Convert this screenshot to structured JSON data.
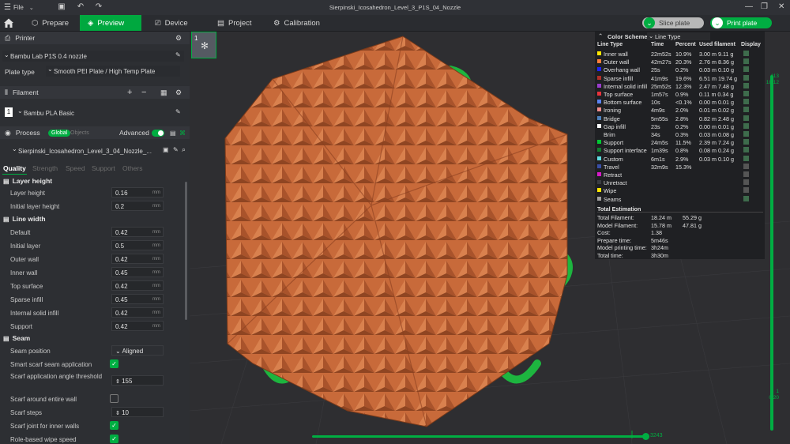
{
  "titlebar": {
    "menu_label": "File",
    "title": "Sierpinski_Icosahedron_Level_3_P1S_04_Nozzle"
  },
  "tabs": [
    {
      "label": "Prepare"
    },
    {
      "label": "Preview"
    },
    {
      "label": "Device"
    },
    {
      "label": "Project"
    },
    {
      "label": "Calibration"
    }
  ],
  "actions": {
    "slice": "Slice plate",
    "print": "Print plate"
  },
  "printer": {
    "section": "Printer",
    "name": "Bambu Lab P1S 0.4 nozzle",
    "plate_label": "Plate type",
    "plate_value": "Smooth PEI Plate / High Temp Plate"
  },
  "filament": {
    "section": "Filament",
    "slot": "1",
    "name": "Bambu PLA Basic"
  },
  "process": {
    "section": "Process",
    "global": "Global",
    "objects": "Objects",
    "advanced": "Advanced",
    "profile": "Sierpinski_Icosahedron_Level_3_04_Nozzle_..."
  },
  "subtabs": [
    "Quality",
    "Strength",
    "Speed",
    "Support",
    "Others"
  ],
  "layer_height": {
    "title": "Layer height",
    "rows": [
      {
        "label": "Layer height",
        "value": "0.16",
        "unit": "mm"
      },
      {
        "label": "Initial layer height",
        "value": "0.2",
        "unit": "mm"
      }
    ]
  },
  "line_width": {
    "title": "Line width",
    "rows": [
      {
        "label": "Default",
        "value": "0.42",
        "unit": "mm"
      },
      {
        "label": "Initial layer",
        "value": "0.5",
        "unit": "mm"
      },
      {
        "label": "Outer wall",
        "value": "0.42",
        "unit": "mm"
      },
      {
        "label": "Inner wall",
        "value": "0.45",
        "unit": "mm"
      },
      {
        "label": "Top surface",
        "value": "0.42",
        "unit": "mm"
      },
      {
        "label": "Sparse infill",
        "value": "0.45",
        "unit": "mm"
      },
      {
        "label": "Internal solid infill",
        "value": "0.42",
        "unit": "mm"
      },
      {
        "label": "Support",
        "value": "0.42",
        "unit": "mm"
      }
    ]
  },
  "seam": {
    "title": "Seam",
    "position_label": "Seam position",
    "position_value": "Aligned",
    "smart_label": "Smart scarf seam application",
    "angle_label": "Scarf application angle threshold",
    "angle_value": "155",
    "around_label": "Scarf around entire wall",
    "steps_label": "Scarf steps",
    "steps_value": "10",
    "inner_label": "Scarf joint for inner walls",
    "wipe_label": "Role-based wipe speed"
  },
  "legend": {
    "header": "Color Scheme",
    "scheme": "Line Type",
    "cols": [
      "Line Type",
      "Time",
      "Percent",
      "Used filament",
      "Display"
    ],
    "rows": [
      {
        "name": "Inner wall",
        "time": "22m52s",
        "pct": "10.9%",
        "used": "3.00 m  9.11 g",
        "color": "#ffe600",
        "on": true
      },
      {
        "name": "Outer wall",
        "time": "42m27s",
        "pct": "20.3%",
        "used": "2.76 m  8.36 g",
        "color": "#ff7d38",
        "on": true
      },
      {
        "name": "Overhang wall",
        "time": "25s",
        "pct": "0.2%",
        "used": "0.03 m  0.10 g",
        "color": "#1f24f5",
        "on": true
      },
      {
        "name": "Sparse infill",
        "time": "41m9s",
        "pct": "19.6%",
        "used": "6.51 m  19.74 g",
        "color": "#b03028",
        "on": true
      },
      {
        "name": "Internal solid infill",
        "time": "25m52s",
        "pct": "12.3%",
        "used": "2.47 m  7.48 g",
        "color": "#9a3ccd",
        "on": true
      },
      {
        "name": "Top surface",
        "time": "1m57s",
        "pct": "0.9%",
        "used": "0.11 m  0.34 g",
        "color": "#e8323c",
        "on": true
      },
      {
        "name": "Bottom surface",
        "time": "10s",
        "pct": "<0.1%",
        "used": "0.00 m  0.01 g",
        "color": "#5a82f0",
        "on": true
      },
      {
        "name": "Ironing",
        "time": "4m9s",
        "pct": "2.0%",
        "used": "0.01 m  0.02 g",
        "color": "#f08c8c",
        "on": true
      },
      {
        "name": "Bridge",
        "time": "5m55s",
        "pct": "2.8%",
        "used": "0.82 m  2.48 g",
        "color": "#4d80ba",
        "on": true
      },
      {
        "name": "Gap infill",
        "time": "23s",
        "pct": "0.2%",
        "used": "0.00 m  0.01 g",
        "color": "#ffffff",
        "on": true
      },
      {
        "name": "Brim",
        "time": "34s",
        "pct": "0.3%",
        "used": "0.03 m  0.08 g",
        "color": "#1f2023",
        "on": true
      },
      {
        "name": "Support",
        "time": "24m5s",
        "pct": "11.5%",
        "used": "2.39 m  7.24 g",
        "color": "#00c832",
        "on": true
      },
      {
        "name": "Support interface",
        "time": "1m39s",
        "pct": "0.8%",
        "used": "0.08 m  0.24 g",
        "color": "#127f2f",
        "on": true
      },
      {
        "name": "Custom",
        "time": "6m1s",
        "pct": "2.9%",
        "used": "0.03 m  0.10 g",
        "color": "#5edde0",
        "on": true
      },
      {
        "name": "Travel",
        "time": "32m9s",
        "pct": "15.3%",
        "used": "",
        "color": "#384ea6",
        "on": false
      },
      {
        "name": "Retract",
        "time": "",
        "pct": "",
        "used": "",
        "color": "#d619c8",
        "on": false
      },
      {
        "name": "Unretract",
        "time": "",
        "pct": "",
        "used": "",
        "color": "#3a3c42",
        "on": false
      },
      {
        "name": "Wipe",
        "time": "",
        "pct": "",
        "used": "",
        "color": "#ffe600",
        "on": false
      },
      {
        "name": "Seams",
        "time": "",
        "pct": "",
        "used": "",
        "color": "#a0a0a0",
        "on": true
      }
    ],
    "total_title": "Total Estimation",
    "totals": [
      {
        "label": "Total Filament:",
        "v1": "18.24 m",
        "v2": "55.29 g"
      },
      {
        "label": "Model Filament:",
        "v1": "15.78 m",
        "v2": "47.81 g"
      },
      {
        "label": "Cost:",
        "v1": "1.38",
        "v2": ""
      },
      {
        "label": "Prepare time:",
        "v1": "5m46s",
        "v2": ""
      },
      {
        "label": "Model printing time:",
        "v1": "3h24m",
        "v2": ""
      },
      {
        "label": "Total time:",
        "v1": "3h30m",
        "v2": ""
      }
    ]
  },
  "slider": {
    "top_layer": "113",
    "top_height": "18.12",
    "bottom_layer": "1",
    "bottom_height": "0.20",
    "move_count": "3243"
  },
  "plate_index": "1",
  "colors": {
    "accent": "#00ae42",
    "model": "#c86a3a"
  }
}
